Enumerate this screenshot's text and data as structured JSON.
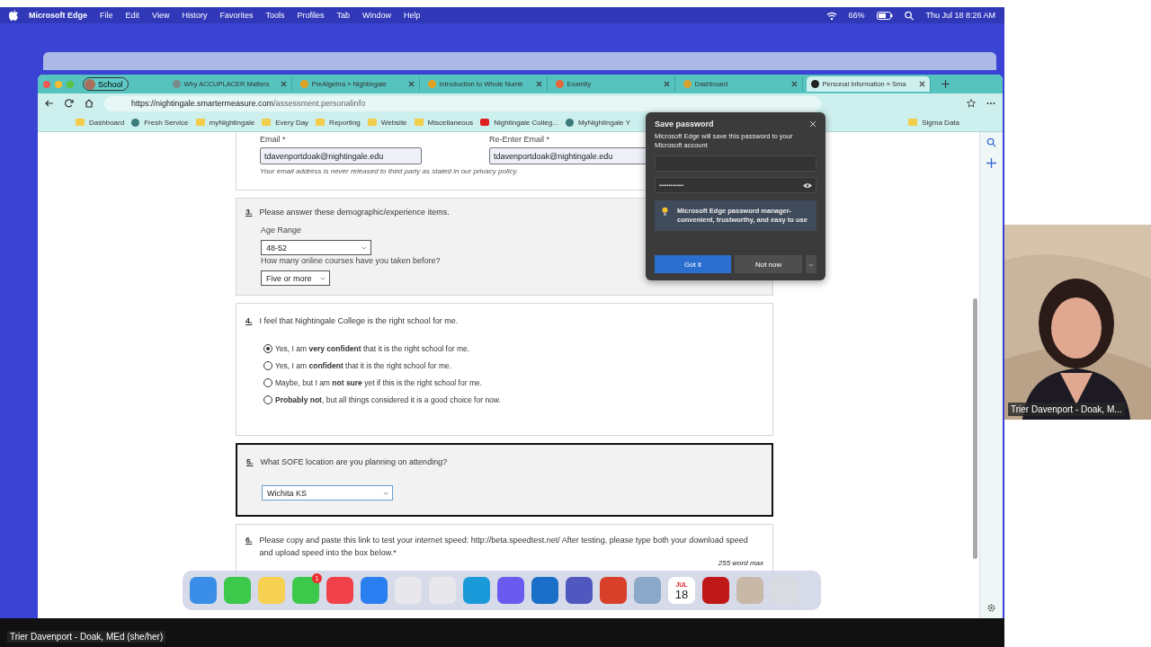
{
  "menubar": {
    "app": "Microsoft Edge",
    "menus": [
      "File",
      "Edit",
      "View",
      "History",
      "Favorites",
      "Tools",
      "Profiles",
      "Tab",
      "Window",
      "Help"
    ],
    "battery": "66%",
    "clock": "Thu Jul 18  8:26 AM"
  },
  "browser": {
    "profile": "School",
    "tabs": [
      {
        "label": "Why ACCUPLACER Matters",
        "selected": false,
        "color": "#7a8a8a"
      },
      {
        "label": "PreAlgebra » Nightingale",
        "selected": false,
        "color": "#e0a020"
      },
      {
        "label": "Introduction to Whole Numb",
        "selected": false,
        "color": "#e0a020"
      },
      {
        "label": "Examity",
        "selected": false,
        "color": "#e8663a"
      },
      {
        "label": "Dashboard",
        "selected": false,
        "color": "#d8a030"
      },
      {
        "label": "Personal Information » Sma",
        "selected": true,
        "color": "#222222"
      }
    ],
    "url_host": "https://nightingale.smartermeasure.com",
    "url_path": "/assessment.personalinfo",
    "bookmarks": [
      {
        "label": "Dashboard",
        "kind": "folder"
      },
      {
        "label": "Fresh Service",
        "kind": "site"
      },
      {
        "label": "myNightingale",
        "kind": "folder"
      },
      {
        "label": "Every Day",
        "kind": "folder"
      },
      {
        "label": "Reporting",
        "kind": "folder"
      },
      {
        "label": "Website",
        "kind": "folder"
      },
      {
        "label": "Miscellaneous",
        "kind": "folder"
      },
      {
        "label": "Nightingale Colleg...",
        "kind": "video"
      },
      {
        "label": "MyNightingale Y",
        "kind": "site"
      }
    ],
    "bookmarks_right": [
      {
        "label": "Sigma Data",
        "kind": "folder"
      }
    ]
  },
  "form": {
    "email": {
      "label": "Email *",
      "value": "tdavenportdoak@nightingale.edu",
      "confirm_label": "Re-Enter Email *",
      "confirm_value": "tdavenportdoak@nightingale.edu",
      "note": "Your email address is never released to third party as stated in our privacy policy."
    },
    "q3": {
      "number": "3.",
      "prompt": "Please answer these demographic/experience items.",
      "age_label": "Age Range",
      "age_value": "48-52",
      "courses_label": "How many online courses have you taken before?",
      "courses_value": "Five or more"
    },
    "q4": {
      "number": "4.",
      "prompt": "I feel that Nightingale College is the right school for me.",
      "options": [
        {
          "text": "Yes, I am **very confident** that it is the right school for me.",
          "selected": true
        },
        {
          "text": "Yes, I am **confident** that it is the right school for me.",
          "selected": false
        },
        {
          "text": "Maybe, but I am **not sure** yet if this is the right school for me.",
          "selected": false
        },
        {
          "text": "**Probably not**, but all things considered it is a good choice for now.",
          "selected": false
        }
      ]
    },
    "q5": {
      "number": "5.",
      "prompt": "What SOFE location are you planning on attending?",
      "value": "Wichita KS"
    },
    "q6": {
      "number": "6.",
      "prompt": "Please copy and paste this link to test your internet speed: http://beta.speedtest.net/ After testing, please type both your download speed and upload speed into the box below.*",
      "word_max": "255 word max"
    }
  },
  "password_popup": {
    "title": "Save password",
    "description": "Microsoft Edge will save this password to your Microsoft account",
    "password": "•••••••••••••",
    "tip": "Microsoft Edge password manager- convenient, trustworthy, and easy to use",
    "primary": "Got it",
    "secondary": "Not now"
  },
  "dock": [
    {
      "color": "#3a8ee8"
    },
    {
      "color": "#3cc84a"
    },
    {
      "color": "#f6d050"
    },
    {
      "color": "#3cc84a",
      "badge": "1"
    },
    {
      "color": "#f0404a"
    },
    {
      "color": "#2a7ef0"
    },
    {
      "color": "#e8e8ec"
    },
    {
      "color": "#e8e8ec"
    },
    {
      "color": "#1a9ad8"
    },
    {
      "color": "#6a5af0"
    },
    {
      "color": "#1a70c8"
    },
    {
      "color": "#5058c0"
    },
    {
      "color": "#d8402a"
    },
    {
      "color": "#8aa8c8"
    },
    {
      "color": "#ffffff",
      "month": "JUL",
      "day": "18"
    },
    {
      "color": "#c01818"
    },
    {
      "color": "#c8b8a8"
    },
    {
      "color": "#d8dce0"
    }
  ],
  "video": {
    "name": "Trier Davenport - Doak, M..."
  },
  "presenter": "Trier Davenport - Doak, MEd (she/her)"
}
